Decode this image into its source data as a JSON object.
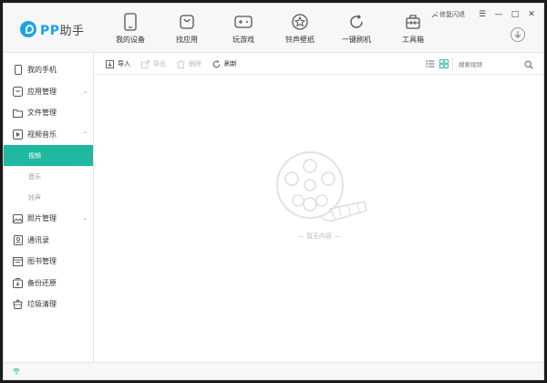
{
  "app": {
    "name_latin": "PP",
    "name_cn": "助手"
  },
  "window_controls": {
    "feedback": "修复闪退",
    "menu": "☰",
    "minimize": "—",
    "maximize": "□",
    "close": "✕"
  },
  "nav": [
    {
      "label": "我的设备",
      "icon": "phone-icon"
    },
    {
      "label": "找应用",
      "icon": "shopping-bag-icon"
    },
    {
      "label": "玩游戏",
      "icon": "gamepad-icon"
    },
    {
      "label": "铃声壁纸",
      "icon": "star-icon"
    },
    {
      "label": "一键刷机",
      "icon": "refresh-icon"
    },
    {
      "label": "工具箱",
      "icon": "toolbox-icon"
    }
  ],
  "sidebar": {
    "items": [
      {
        "label": "我的手机",
        "icon": "phone-icon"
      },
      {
        "label": "应用管理",
        "icon": "apps-icon",
        "arrow": "⌄"
      },
      {
        "label": "文件管理",
        "icon": "folder-icon"
      },
      {
        "label": "视频音乐",
        "icon": "play-icon",
        "arrow": "⌃"
      },
      {
        "label": "照片管理",
        "icon": "photo-icon",
        "arrow": "⌄"
      },
      {
        "label": "通讯录",
        "icon": "contacts-icon"
      },
      {
        "label": "图书管理",
        "icon": "book-icon"
      },
      {
        "label": "备份还原",
        "icon": "backup-icon"
      },
      {
        "label": "垃圾清理",
        "icon": "trash-icon"
      }
    ],
    "sub_media": [
      {
        "label": "视频",
        "active": true
      },
      {
        "label": "音乐",
        "active": false
      },
      {
        "label": "铃声",
        "active": false
      }
    ]
  },
  "toolbar": {
    "import": "导入",
    "export": "导出",
    "delete": "删除",
    "refresh": "刷新",
    "search_placeholder": "搜索视频"
  },
  "content": {
    "empty_text": "— 暂无内容 —"
  },
  "colors": {
    "accent": "#20b8a0",
    "brand": "#1aa3e8"
  }
}
